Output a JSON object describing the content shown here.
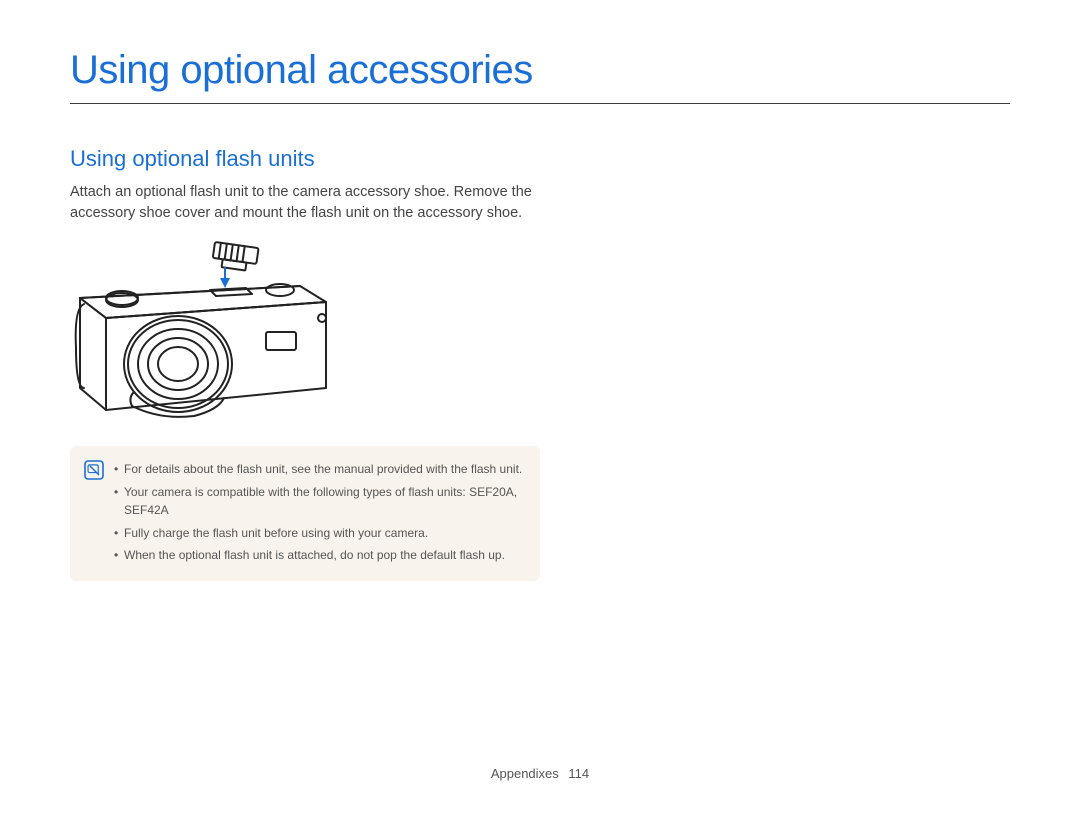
{
  "title": "Using optional accessories",
  "section": {
    "heading": "Using optional flash units",
    "body": "Attach an optional flash unit to the camera accessory shoe. Remove the accessory shoe cover and mount the flash unit on the accessory shoe."
  },
  "notes": {
    "items": [
      "For details about the flash unit, see the manual provided with the flash unit.",
      "Your camera is compatible with the following types of flash units: SEF20A, SEF42A",
      "Fully charge the flash unit before using with your camera.",
      "When the optional flash unit is attached, do not pop the default flash up."
    ]
  },
  "footer": {
    "section": "Appendixes",
    "page": "114"
  }
}
